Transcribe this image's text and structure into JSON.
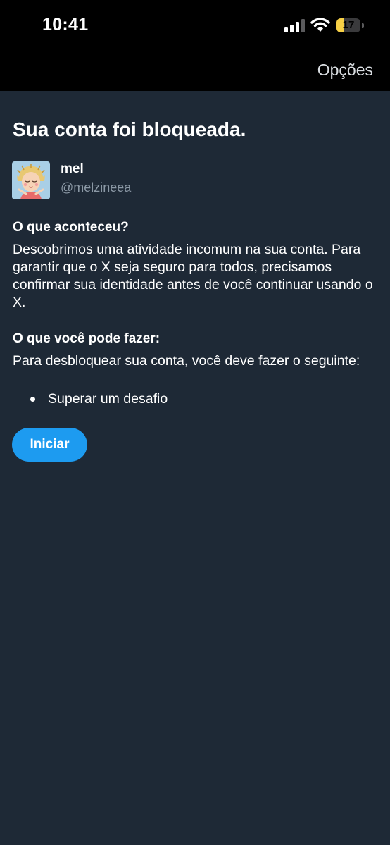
{
  "status_bar": {
    "time": "10:41",
    "battery_level": "17",
    "battery_fraction": 0.17,
    "icons": [
      "signal-icon",
      "wifi-icon",
      "battery-icon"
    ]
  },
  "header": {
    "options_label": "Opções"
  },
  "main": {
    "title": "Sua conta foi bloqueada.",
    "user": {
      "display_name": "mel",
      "handle": "@melzineea",
      "avatar_icon": "avatar-illustration"
    },
    "what_happened": {
      "heading": "O que aconteceu?",
      "body": "Descobrimos uma atividade incomum na sua conta. Para garantir que o X seja seguro para todos, precisamos confirmar sua identidade antes de você continuar usando o X."
    },
    "what_to_do": {
      "heading": "O que você pode fazer:",
      "body": "Para desbloquear sua conta, você deve fazer o seguinte:",
      "steps": [
        "Superar um desafio"
      ]
    },
    "start_button_label": "Iniciar"
  },
  "colors": {
    "background": "#1e2936",
    "top_bar": "#000000",
    "accent": "#1d9bf0",
    "secondary_text": "#8b98a5",
    "battery_fill": "#f7d046"
  }
}
